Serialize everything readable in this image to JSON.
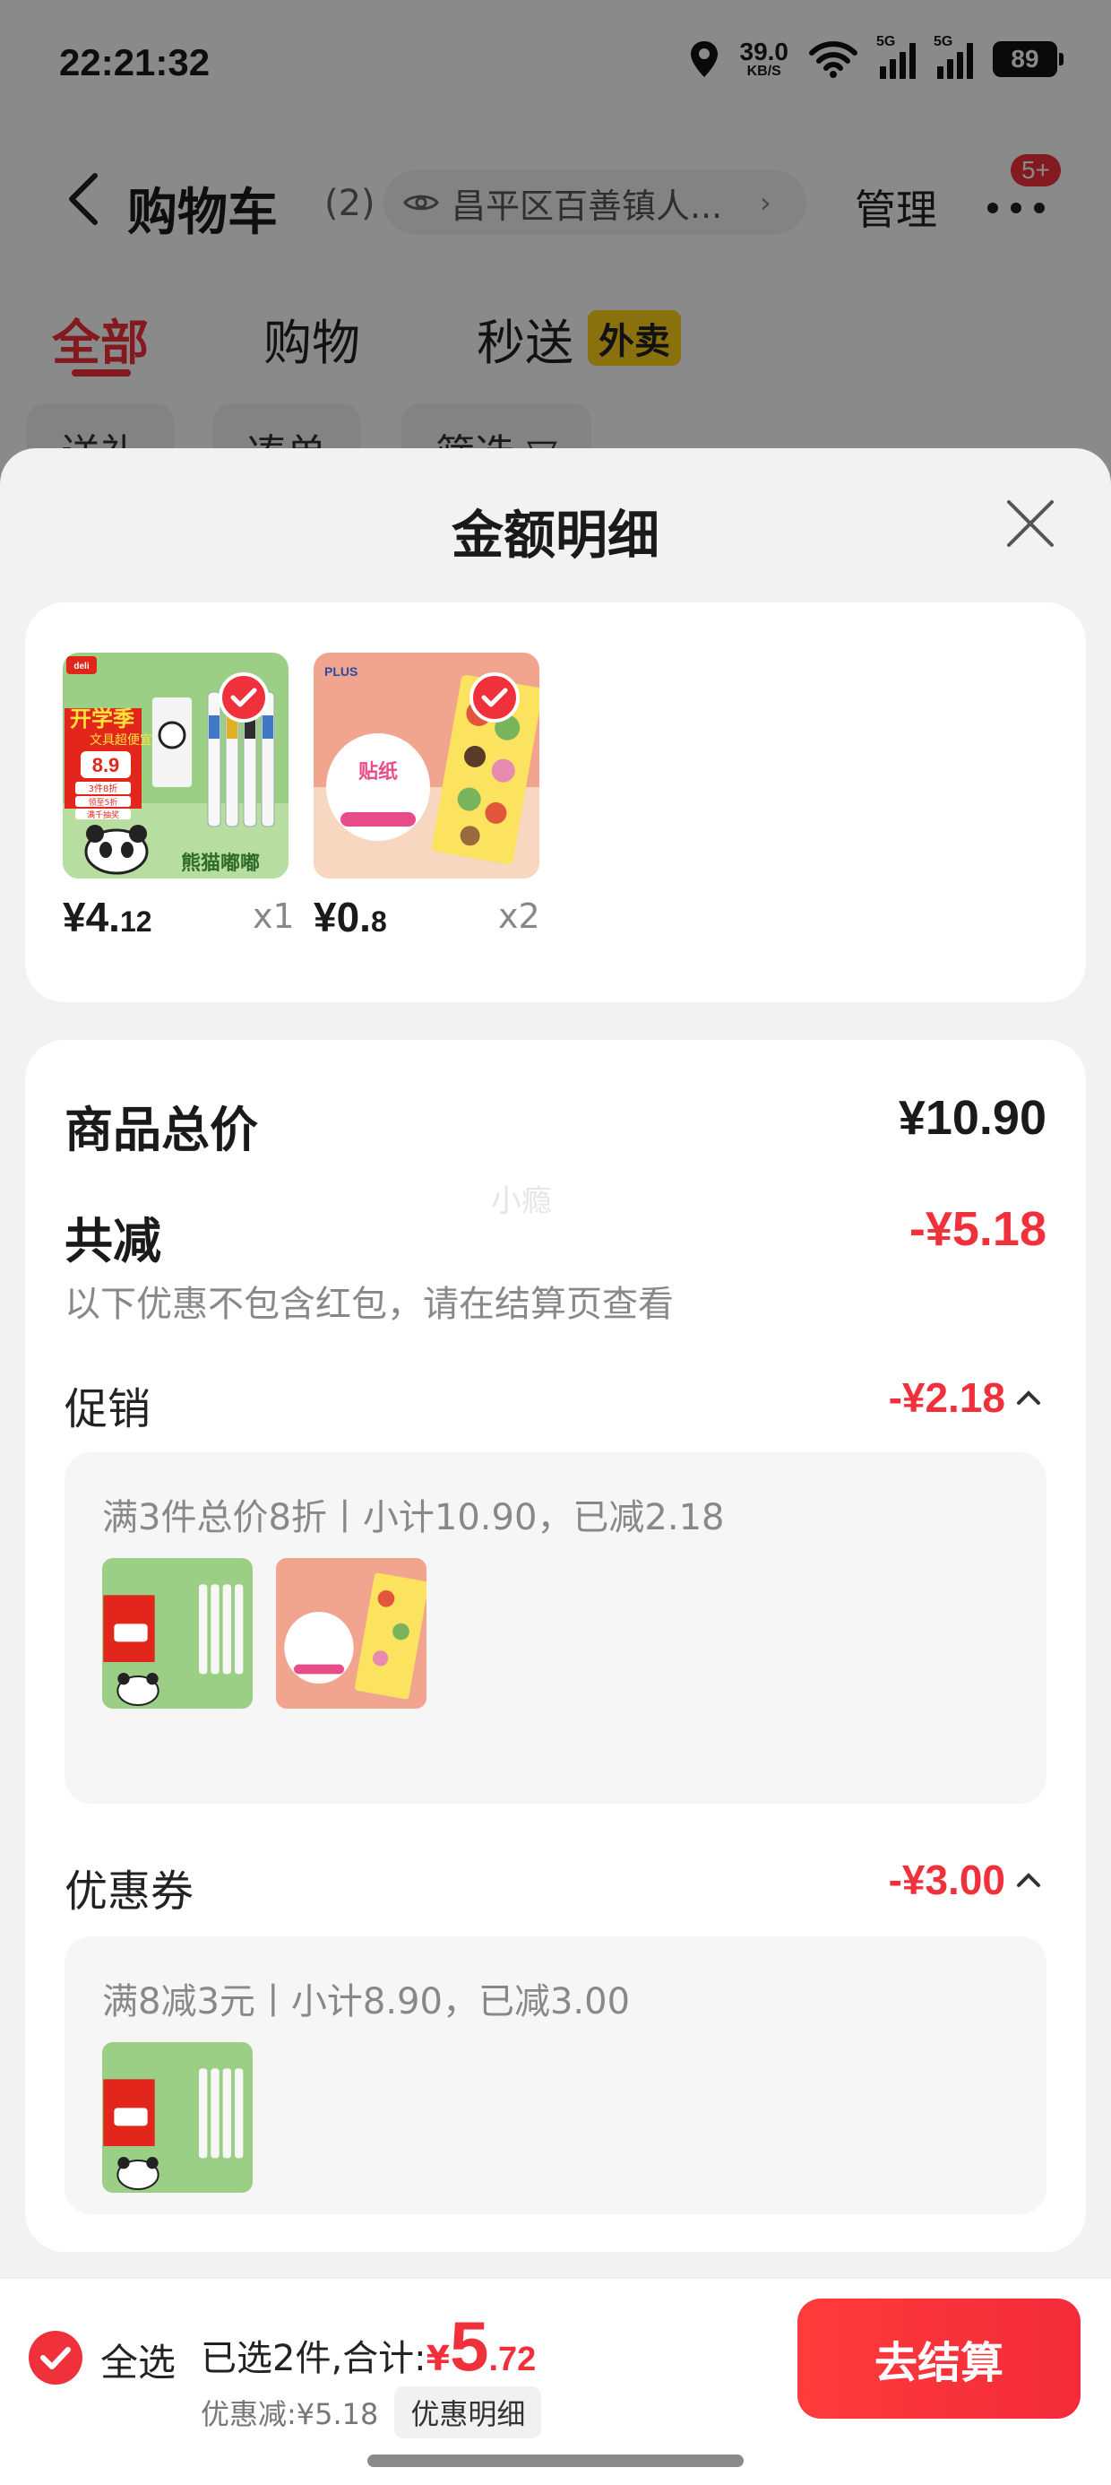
{
  "status_bar": {
    "time": "22:21:32",
    "net_speed_value": "39.0",
    "net_speed_unit": "KB/S",
    "signal1_label": "5G",
    "signal2_label": "5G",
    "battery": "89"
  },
  "nav": {
    "title": "购物车",
    "count": "(2)",
    "location": "昌平区百善镇人...",
    "manage_label": "管理",
    "more_badge": "5+"
  },
  "tabs": [
    {
      "label": "全部"
    },
    {
      "label": "购物"
    },
    {
      "label": "秒送"
    }
  ],
  "waimai_badge": "外卖",
  "filters": [
    {
      "label": "送礼"
    },
    {
      "label": "凑单"
    },
    {
      "label": "筛选 ▽"
    }
  ],
  "sheet": {
    "title": "金额明细",
    "items": [
      {
        "price_int": "¥4.",
        "price_dec": "12",
        "qty": "x1",
        "brand": "deli",
        "promo_title": "开学季",
        "promo_sub": "文具超便宜",
        "promo_price": "8.9",
        "tag1": "3件8折",
        "tag2": "领至5折",
        "tag3": "满千抽奖",
        "banner": "熊猫嘟嘟"
      },
      {
        "price_int": "¥0.",
        "price_dec": "8",
        "qty": "x2",
        "brand": "PLUS",
        "label": "贴纸"
      }
    ],
    "summary": {
      "total_label": "商品总价",
      "total_value": "¥10.90",
      "reduce_label": "共减",
      "reduce_value": "-¥5.18",
      "watermark": "小瘾",
      "note": "以下优惠不包含红包，请在结算页查看"
    },
    "promotion": {
      "label": "促销",
      "value": "-¥2.18",
      "detail": "满3件总价8折丨小计10.90，已减2.18"
    },
    "coupon": {
      "label": "优惠券",
      "value": "-¥3.00",
      "detail": "满8减3元丨小计8.90，已减3.00"
    }
  },
  "bottom": {
    "select_all": "全选",
    "total_prefix": "已选2件,合计:",
    "currency": "¥",
    "total_int": "5",
    "total_dec": ".72",
    "discount": "优惠减:¥5.18",
    "detail_button": "优惠明细",
    "checkout_button": "去结算"
  },
  "colors": {
    "accent": "#f0303a",
    "badge_yellow": "#ffd11a"
  }
}
